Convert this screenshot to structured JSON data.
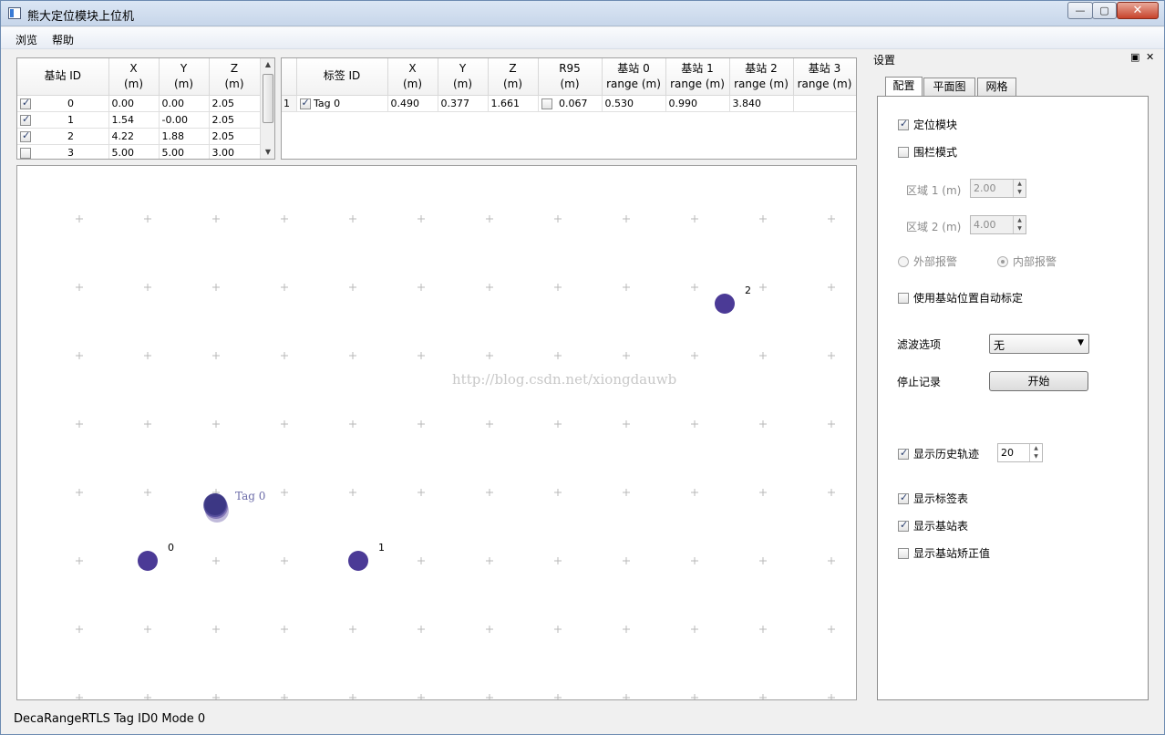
{
  "window": {
    "title": "熊大定位模块上位机",
    "minimize": "—",
    "maximize": "▢",
    "close": "✕"
  },
  "menu": {
    "items": [
      "浏览",
      "帮助"
    ]
  },
  "anchor_table": {
    "headers": [
      {
        "line1": "基站 ID",
        "line2": ""
      },
      {
        "line1": "X",
        "line2": "(m)"
      },
      {
        "line1": "Y",
        "line2": "(m)"
      },
      {
        "line1": "Z",
        "line2": "(m)"
      }
    ],
    "rows": [
      {
        "checked": true,
        "id": "0",
        "x": "0.00",
        "y": "0.00",
        "z": "2.05"
      },
      {
        "checked": true,
        "id": "1",
        "x": "1.54",
        "y": "-0.00",
        "z": "2.05"
      },
      {
        "checked": true,
        "id": "2",
        "x": "4.22",
        "y": "1.88",
        "z": "2.05"
      },
      {
        "checked": false,
        "id": "3",
        "x": "5.00",
        "y": "5.00",
        "z": "3.00"
      }
    ]
  },
  "tag_table": {
    "headers": [
      {
        "line1": "",
        "line2": ""
      },
      {
        "line1": "标签 ID",
        "line2": ""
      },
      {
        "line1": "X",
        "line2": "(m)"
      },
      {
        "line1": "Y",
        "line2": "(m)"
      },
      {
        "line1": "Z",
        "line2": "(m)"
      },
      {
        "line1": "R95",
        "line2": "(m)"
      },
      {
        "line1": "基站 0",
        "line2": "range (m)"
      },
      {
        "line1": "基站 1",
        "line2": "range (m)"
      },
      {
        "line1": "基站 2",
        "line2": "range (m)"
      },
      {
        "line1": "基站 3",
        "line2": "range (m)"
      }
    ],
    "rows": [
      {
        "num": "1",
        "checked": true,
        "id": "Tag 0",
        "x": "0.490",
        "y": "0.377",
        "z": "1.661",
        "r95_checked": false,
        "r95": "0.067",
        "r0": "0.530",
        "r1": "0.990",
        "r2": "3.840",
        "r3": ""
      }
    ]
  },
  "canvas": {
    "watermark": "http://blog.csdn.net/xiongdauwb",
    "tag_label": "Tag 0",
    "anchors": [
      {
        "label": "0"
      },
      {
        "label": "1"
      },
      {
        "label": "2"
      }
    ],
    "point_color": "#4b3a96",
    "grid_color": "#b8b8b8"
  },
  "settings": {
    "title": "设置",
    "float_icon": "▣",
    "close_icon": "✕",
    "tabs": [
      "配置",
      "平面图",
      "网格"
    ],
    "locate_module": {
      "label": "定位模块",
      "checked": true
    },
    "fence_mode": {
      "label": "围栏模式",
      "checked": false
    },
    "zone1": {
      "label": "区域 1 (m)",
      "value": "2.00"
    },
    "zone2": {
      "label": "区域 2 (m)",
      "value": "4.00"
    },
    "outer_alarm": "外部报警",
    "inner_alarm": "内部报警",
    "auto_calib": {
      "label": "使用基站位置自动标定",
      "checked": false
    },
    "filter_label": "滤波选项",
    "filter_value": "无",
    "log_label": "停止记录",
    "log_button": "开始",
    "history": {
      "label": "显示历史轨迹",
      "checked": true,
      "value": "20"
    },
    "show_tag_table": {
      "label": "显示标签表",
      "checked": true
    },
    "show_anchor_table": {
      "label": "显示基站表",
      "checked": true
    },
    "show_anchor_correction": {
      "label": "显示基站矫正值",
      "checked": false
    }
  },
  "status": {
    "text": "DecaRangeRTLS Tag ID0 Mode 0"
  }
}
